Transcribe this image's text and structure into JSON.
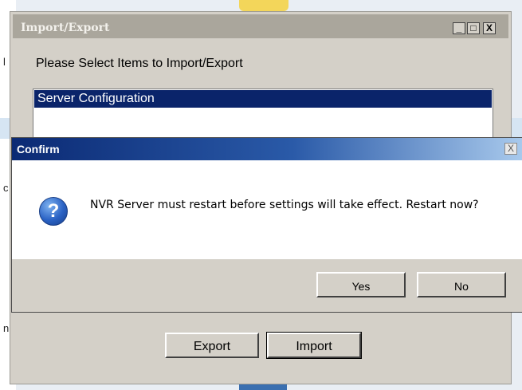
{
  "background": {
    "side_chars": [
      "l",
      "c",
      "n"
    ]
  },
  "import_export": {
    "title": "Import/Export",
    "controls": {
      "minimize": "_",
      "maximize": "□",
      "close": "X"
    },
    "prompt": "Please Select Items to Import/Export",
    "items": [
      {
        "label": "Server Configuration",
        "selected": true
      }
    ],
    "export_label": "Export",
    "import_label": "Import"
  },
  "confirm": {
    "title": "Confirm",
    "close": "X",
    "icon": "question-icon",
    "message": "NVR Server must restart before settings will take effect. Restart now?",
    "yes_label": "Yes",
    "no_label": "No"
  },
  "colors": {
    "selection": "#0a246a",
    "title_gradient_start": "#0b2a74",
    "title_gradient_end": "#a8c9ec"
  }
}
